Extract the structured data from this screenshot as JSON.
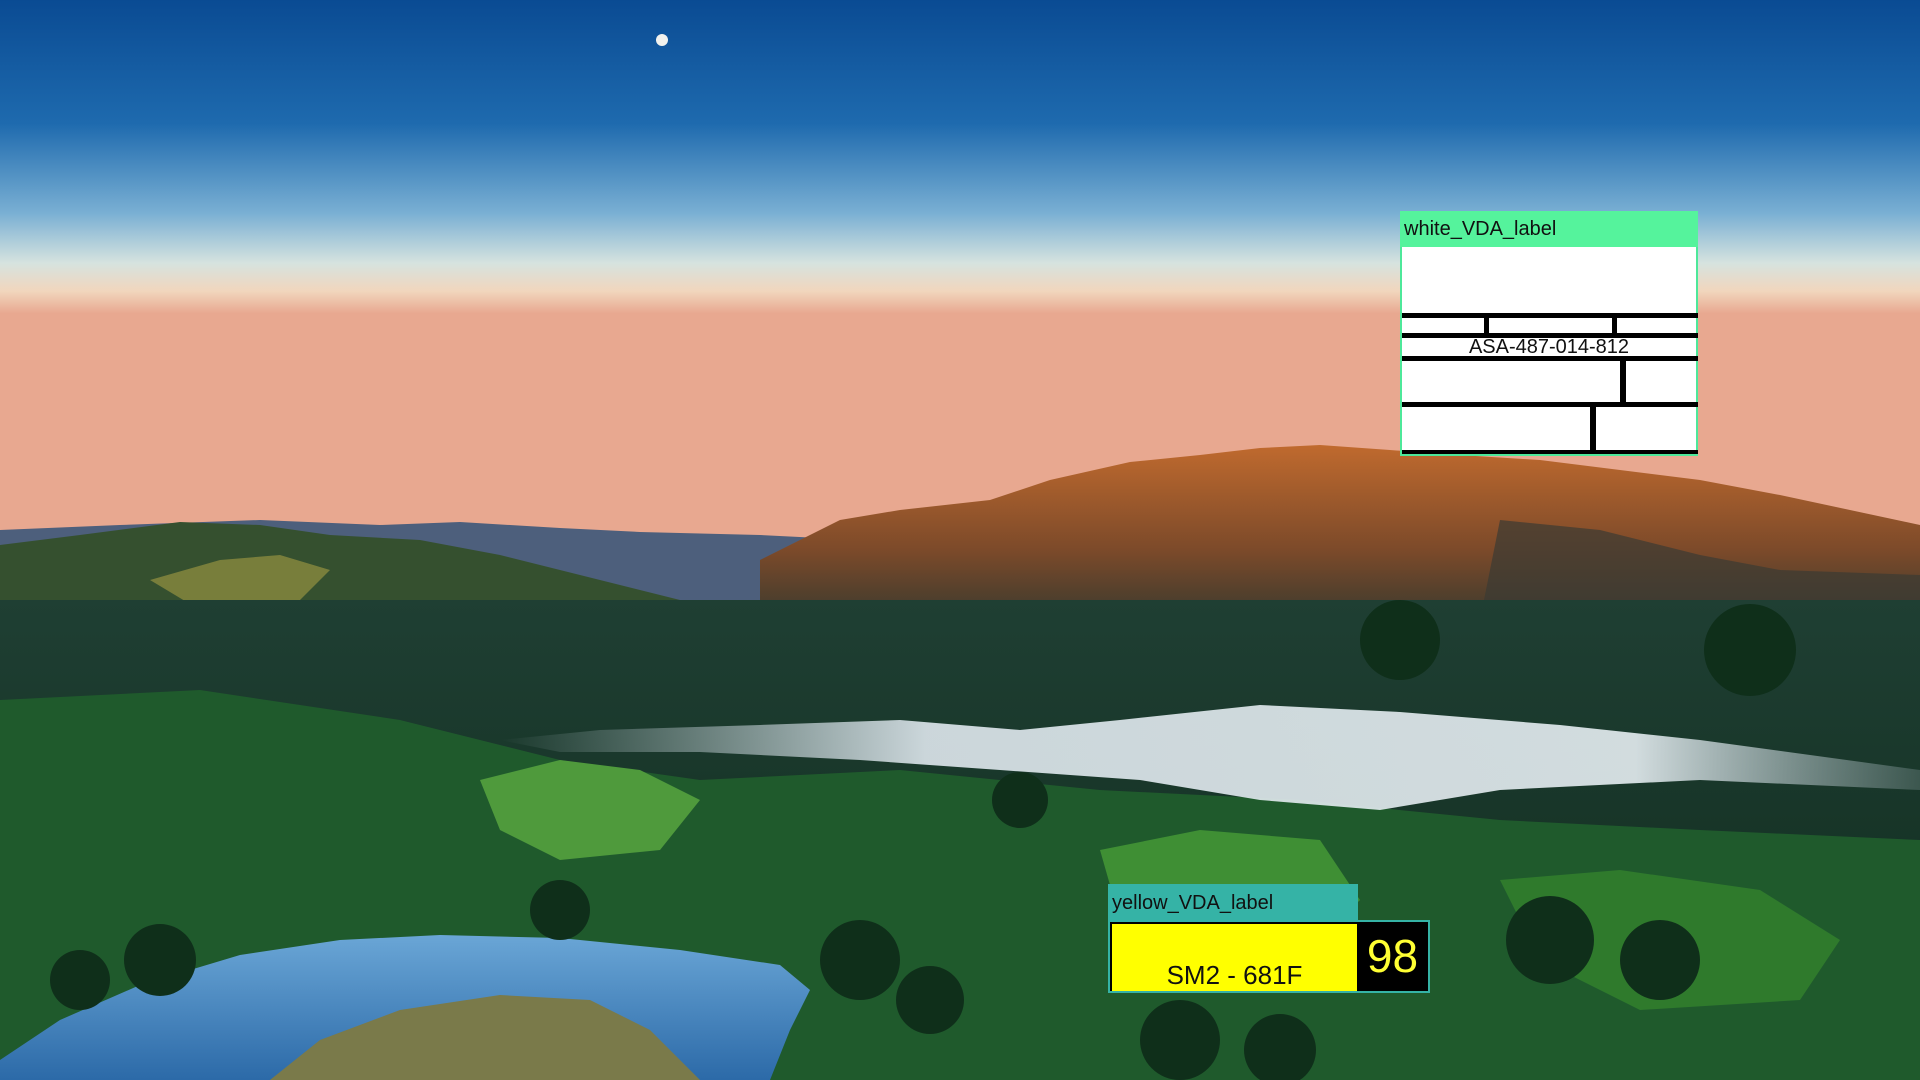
{
  "scene": {
    "description_icon": "landscape-photo",
    "moon_icon": "moon-icon"
  },
  "labels": {
    "white": {
      "tab_title": "white_VDA_label",
      "code": "ASA-487-014-812",
      "tab_color": "#55f39c"
    },
    "yellow": {
      "tab_title": "yellow_VDA_label",
      "plate_text": "SM2 - 681F",
      "number": "98",
      "tab_color": "#35b3a6",
      "plate_color": "#ffff00"
    }
  }
}
